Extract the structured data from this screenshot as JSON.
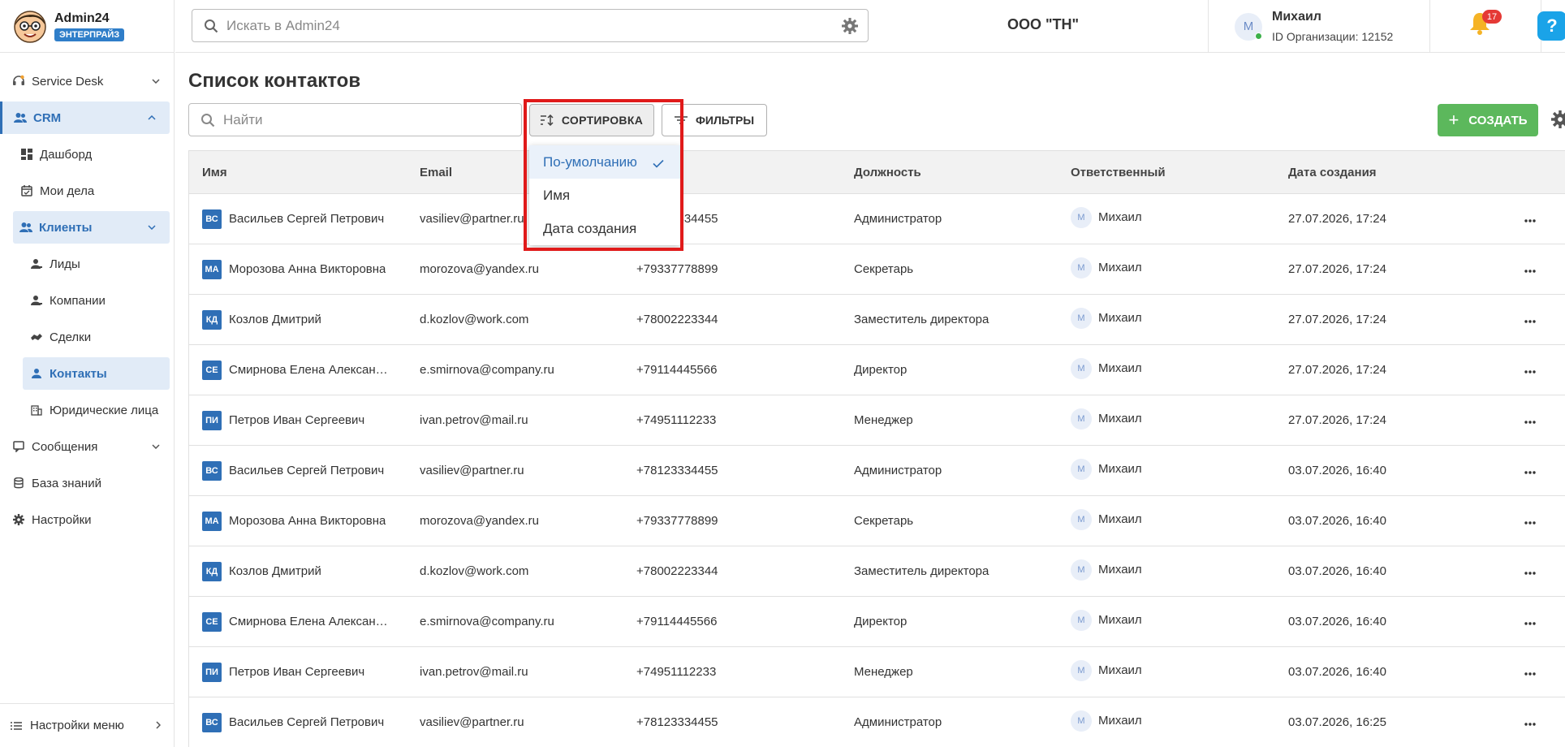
{
  "app": {
    "name": "Admin24",
    "edition": "ЭНТЕРПРАЙЗ"
  },
  "header": {
    "search_placeholder": "Искать в Admin24",
    "org_name": "ООО \"ТН\"",
    "user": {
      "initial": "M",
      "name": "Михаил",
      "org_id": "ID Организации: 12152"
    },
    "notifications_count": "17",
    "help_label": "?"
  },
  "sidebar": {
    "items": [
      {
        "label": "Service Desk",
        "icon": "headset-icon"
      },
      {
        "label": "CRM",
        "icon": "users-icon"
      },
      {
        "label": "Дашборд",
        "icon": "dashboard-icon"
      },
      {
        "label": "Мои дела",
        "icon": "calendar-icon"
      },
      {
        "label": "Клиенты",
        "icon": "clients-icon"
      },
      {
        "label": "Лиды",
        "icon": "lead-icon"
      },
      {
        "label": "Компании",
        "icon": "company-icon"
      },
      {
        "label": "Сделки",
        "icon": "handshake-icon"
      },
      {
        "label": "Контакты",
        "icon": "contact-icon"
      },
      {
        "label": "Юридические лица",
        "icon": "building-icon"
      },
      {
        "label": "Сообщения",
        "icon": "message-icon"
      },
      {
        "label": "База знаний",
        "icon": "database-icon"
      },
      {
        "label": "Настройки",
        "icon": "gear-icon"
      }
    ],
    "menu_settings": "Настройки меню"
  },
  "main": {
    "title": "Список контактов",
    "search_placeholder": "Найти",
    "sort_label": "СОРТИРОВКА",
    "filter_label": "ФИЛЬТРЫ",
    "create_label": "СОЗДАТЬ",
    "sort_options": [
      {
        "label": "По-умолчанию",
        "selected": true
      },
      {
        "label": "Имя",
        "selected": false
      },
      {
        "label": "Дата создания",
        "selected": false
      }
    ]
  },
  "table": {
    "columns": [
      "Имя",
      "Email",
      "",
      "Должность",
      "Ответственный",
      "Дата создания"
    ],
    "rows": [
      {
        "initials": "ВС",
        "name": "Васильев Сергей Петрович",
        "email": "vasiliev@partner.ru",
        "phone": "+78123334455",
        "position": "Администратор",
        "resp_initial": "M",
        "resp": "Михаил",
        "date": "27.07.2026, 17:24"
      },
      {
        "initials": "МА",
        "name": "Морозова Анна Викторовна",
        "email": "morozova@yandex.ru",
        "phone": "+79337778899",
        "position": "Секретарь",
        "resp_initial": "M",
        "resp": "Михаил",
        "date": "27.07.2026, 17:24"
      },
      {
        "initials": "КД",
        "name": "Козлов Дмитрий",
        "email": "d.kozlov@work.com",
        "phone": "+78002223344",
        "position": "Заместитель директора",
        "resp_initial": "M",
        "resp": "Михаил",
        "date": "27.07.2026, 17:24"
      },
      {
        "initials": "СЕ",
        "name": "Смирнова Елена Александровна",
        "email": "e.smirnova@company.ru",
        "phone": "+79114445566",
        "position": "Директор",
        "resp_initial": "M",
        "resp": "Михаил",
        "date": "27.07.2026, 17:24"
      },
      {
        "initials": "ПИ",
        "name": "Петров Иван Сергеевич",
        "email": "ivan.petrov@mail.ru",
        "phone": "+74951112233",
        "position": "Менеджер",
        "resp_initial": "M",
        "resp": "Михаил",
        "date": "27.07.2026, 17:24"
      },
      {
        "initials": "ВС",
        "name": "Васильев Сергей Петрович",
        "email": "vasiliev@partner.ru",
        "phone": "+78123334455",
        "position": "Администратор",
        "resp_initial": "M",
        "resp": "Михаил",
        "date": "03.07.2026, 16:40"
      },
      {
        "initials": "МА",
        "name": "Морозова Анна Викторовна",
        "email": "morozova@yandex.ru",
        "phone": "+79337778899",
        "position": "Секретарь",
        "resp_initial": "M",
        "resp": "Михаил",
        "date": "03.07.2026, 16:40"
      },
      {
        "initials": "КД",
        "name": "Козлов Дмитрий",
        "email": "d.kozlov@work.com",
        "phone": "+78002223344",
        "position": "Заместитель директора",
        "resp_initial": "M",
        "resp": "Михаил",
        "date": "03.07.2026, 16:40"
      },
      {
        "initials": "СЕ",
        "name": "Смирнова Елена Александровна",
        "email": "e.smirnova@company.ru",
        "phone": "+79114445566",
        "position": "Директор",
        "resp_initial": "M",
        "resp": "Михаил",
        "date": "03.07.2026, 16:40"
      },
      {
        "initials": "ПИ",
        "name": "Петров Иван Сергеевич",
        "email": "ivan.petrov@mail.ru",
        "phone": "+74951112233",
        "position": "Менеджер",
        "resp_initial": "M",
        "resp": "Михаил",
        "date": "03.07.2026, 16:40"
      },
      {
        "initials": "ВС",
        "name": "Васильев Сергей Петрович",
        "email": "vasiliev@partner.ru",
        "phone": "+78123334455",
        "position": "Администратор",
        "resp_initial": "M",
        "resp": "Михаил",
        "date": "03.07.2026, 16:25"
      }
    ]
  },
  "colors": {
    "accent": "#2f6fb6",
    "create": "#5cb85c",
    "highlight": "#e01a1a",
    "badge": "#e53935"
  }
}
